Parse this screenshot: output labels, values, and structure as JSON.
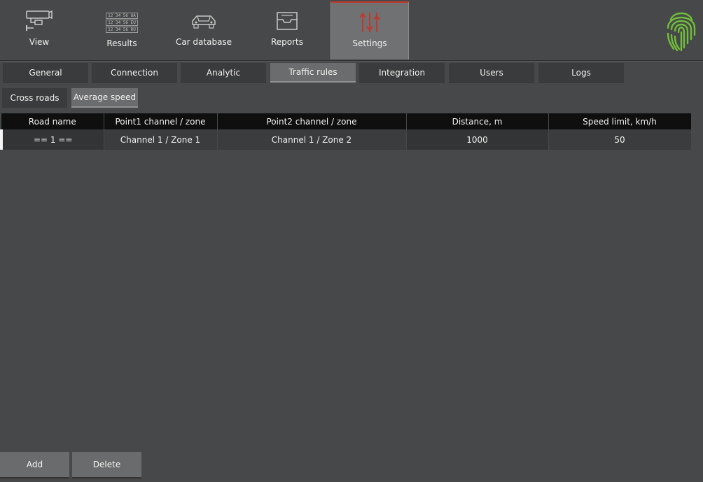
{
  "toolbar": {
    "items": [
      {
        "label": "View",
        "icon": "camera-icon"
      },
      {
        "label": "Results",
        "icon": "plates-icon",
        "plates": [
          "12 34 56 UA",
          "12 34 56 EU",
          "12 34 56 RU"
        ]
      },
      {
        "label": "Car database",
        "icon": "car-icon"
      },
      {
        "label": "Reports",
        "icon": "tray-icon"
      },
      {
        "label": "Settings",
        "icon": "sliders-icon",
        "active": true
      }
    ],
    "accent_color": "#c0392b",
    "logo_icon": "fingerprint-icon",
    "logo_color": "#6fbf3a"
  },
  "tabs": {
    "items": [
      "General",
      "Connection",
      "Analytic",
      "Traffic rules",
      "Integration",
      "Users",
      "Logs"
    ],
    "active": "Traffic rules"
  },
  "subtabs": {
    "items": [
      "Cross roads",
      "Average speed"
    ],
    "active": "Average speed"
  },
  "table": {
    "columns": [
      "Road name",
      "Point1 channel / zone",
      "Point2 channel / zone",
      "Distance, m",
      "Speed limit, km/h"
    ],
    "rows": [
      [
        "== 1 ==",
        "Channel 1 / Zone 1",
        "Channel 1 / Zone 2",
        "1000",
        "50"
      ]
    ]
  },
  "actions": {
    "add_label": "Add",
    "delete_label": "Delete"
  }
}
